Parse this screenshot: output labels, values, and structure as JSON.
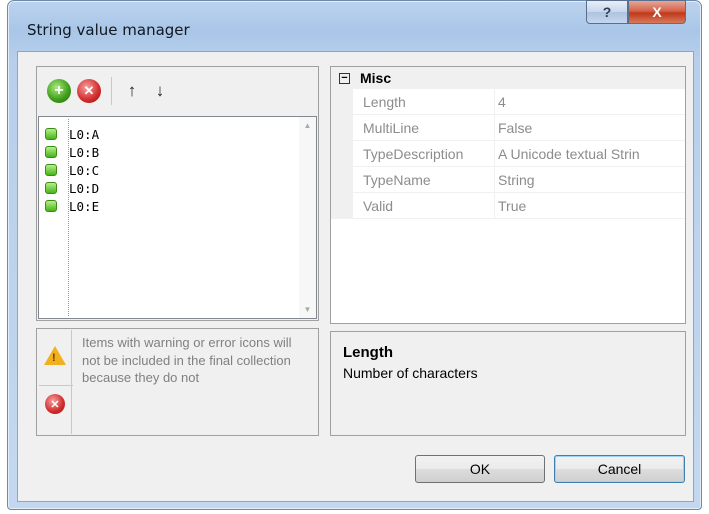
{
  "window": {
    "title": "String value manager",
    "help_label": "?",
    "close_label": "X"
  },
  "toolbar": {
    "add_icon": "plus",
    "remove_icon": "x",
    "move_up_label": "↑",
    "move_down_label": "↓"
  },
  "items": [
    {
      "label": "L0:A",
      "status": "valid"
    },
    {
      "label": "L0:B",
      "status": "valid"
    },
    {
      "label": "L0:C",
      "status": "valid"
    },
    {
      "label": "L0:D",
      "status": "valid"
    },
    {
      "label": "L0:E",
      "status": "valid"
    }
  ],
  "warning": {
    "text": "Items with warning or error icons will not be included in the final collection because they do not"
  },
  "properties": {
    "category": "Misc",
    "category_toggle": "−",
    "rows": [
      {
        "name": "Length",
        "value": "4"
      },
      {
        "name": "MultiLine",
        "value": "False"
      },
      {
        "name": "TypeDescription",
        "value": "A Unicode textual Strin"
      },
      {
        "name": "TypeName",
        "value": "String"
      },
      {
        "name": "Valid",
        "value": "True"
      }
    ]
  },
  "description": {
    "title": "Length",
    "text": "Number of characters"
  },
  "buttons": {
    "ok_label": "OK",
    "cancel_label": "Cancel"
  },
  "colors": {
    "valid_status": "#48b21b",
    "warning": "#f2b01e",
    "error": "#d12a2a"
  }
}
